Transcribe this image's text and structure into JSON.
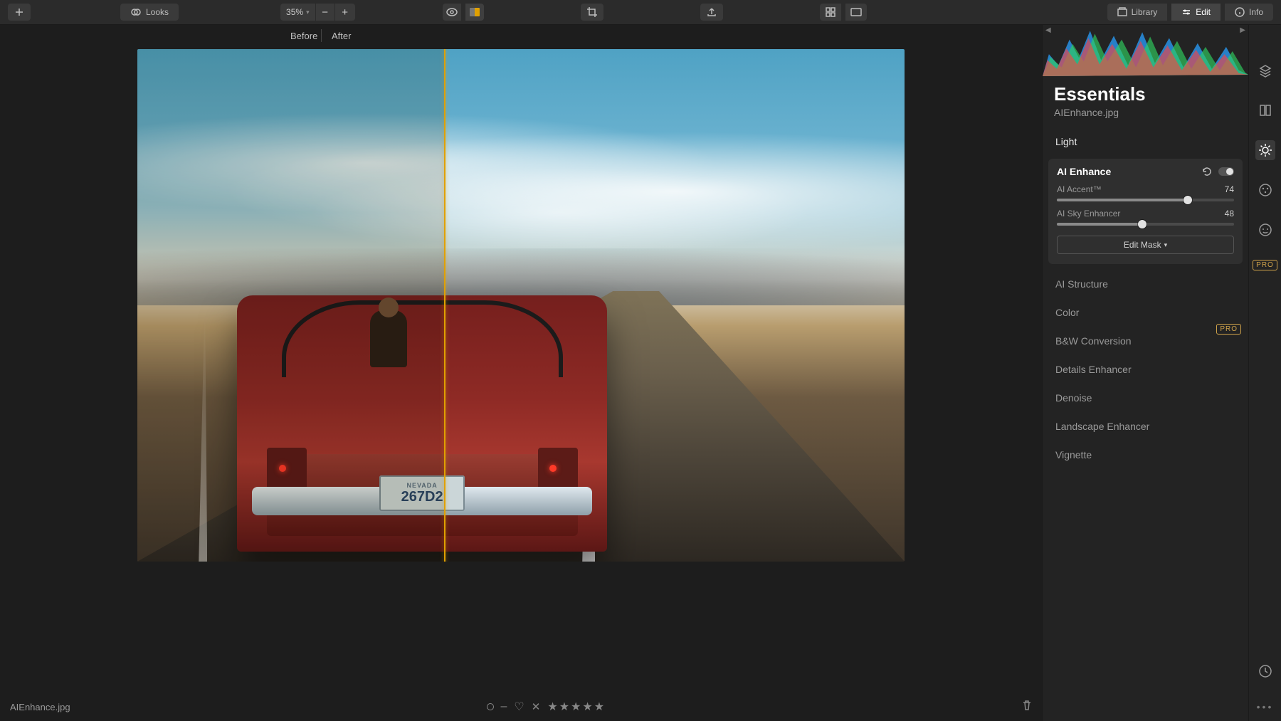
{
  "topbar": {
    "looks_label": "Looks",
    "zoom": "35%",
    "zoom_caret": "▾",
    "library_label": "Library",
    "edit_label": "Edit",
    "info_label": "Info"
  },
  "compare": {
    "before_label": "Before",
    "after_label": "After",
    "split_percent": 40
  },
  "photo": {
    "plate_state": "NEVADA",
    "plate_number": "267D2"
  },
  "right": {
    "panel_title": "Essentials",
    "filename": "AIEnhance.jpg",
    "pro_tag": "PRO",
    "tools": {
      "light": "Light",
      "ai_enhance": "AI Enhance",
      "ai_accent_label": "AI Accent™",
      "ai_accent_value": 74,
      "ai_sky_label": "AI Sky Enhancer",
      "ai_sky_value": 48,
      "edit_mask": "Edit Mask",
      "ai_structure": "AI Structure",
      "color": "Color",
      "bw": "B&W Conversion",
      "details": "Details Enhancer",
      "denoise": "Denoise",
      "landscape": "Landscape Enhancer",
      "vignette": "Vignette"
    }
  },
  "bottom": {
    "filename": "AIEnhance.jpg",
    "color_tag": "–",
    "stars": "★★★★★"
  }
}
